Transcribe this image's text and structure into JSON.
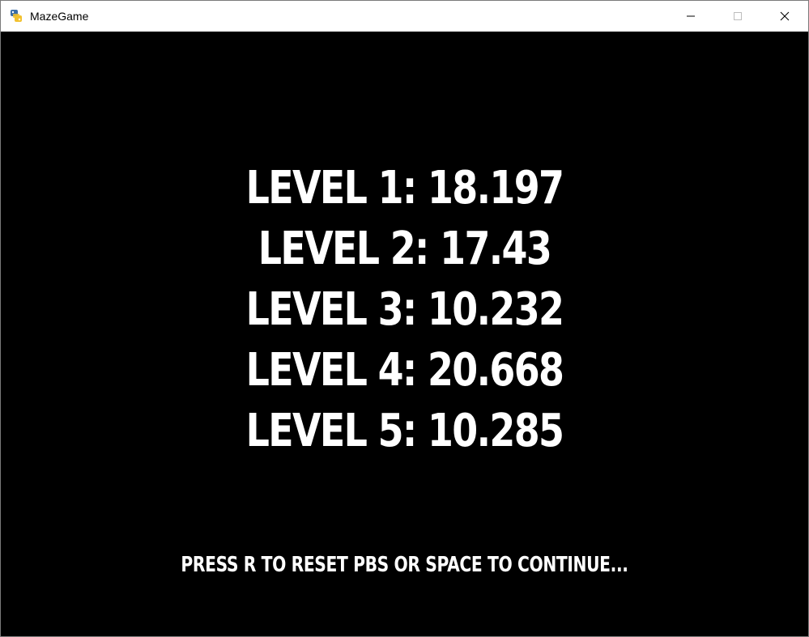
{
  "window": {
    "title": "MazeGame",
    "icon": "python-snake-icon"
  },
  "game": {
    "levels": [
      {
        "text": "LEVEL 1: 18.197"
      },
      {
        "text": "LEVEL 2: 17.43"
      },
      {
        "text": "LEVEL 3: 10.232"
      },
      {
        "text": "LEVEL 4: 20.668"
      },
      {
        "text": "LEVEL 5: 10.285"
      }
    ],
    "hint": "PRESS R TO RESET PBS OR SPACE TO CONTINUE..."
  },
  "colors": {
    "background": "#000000",
    "text": "#ffffff",
    "titlebar": "#ffffff"
  }
}
